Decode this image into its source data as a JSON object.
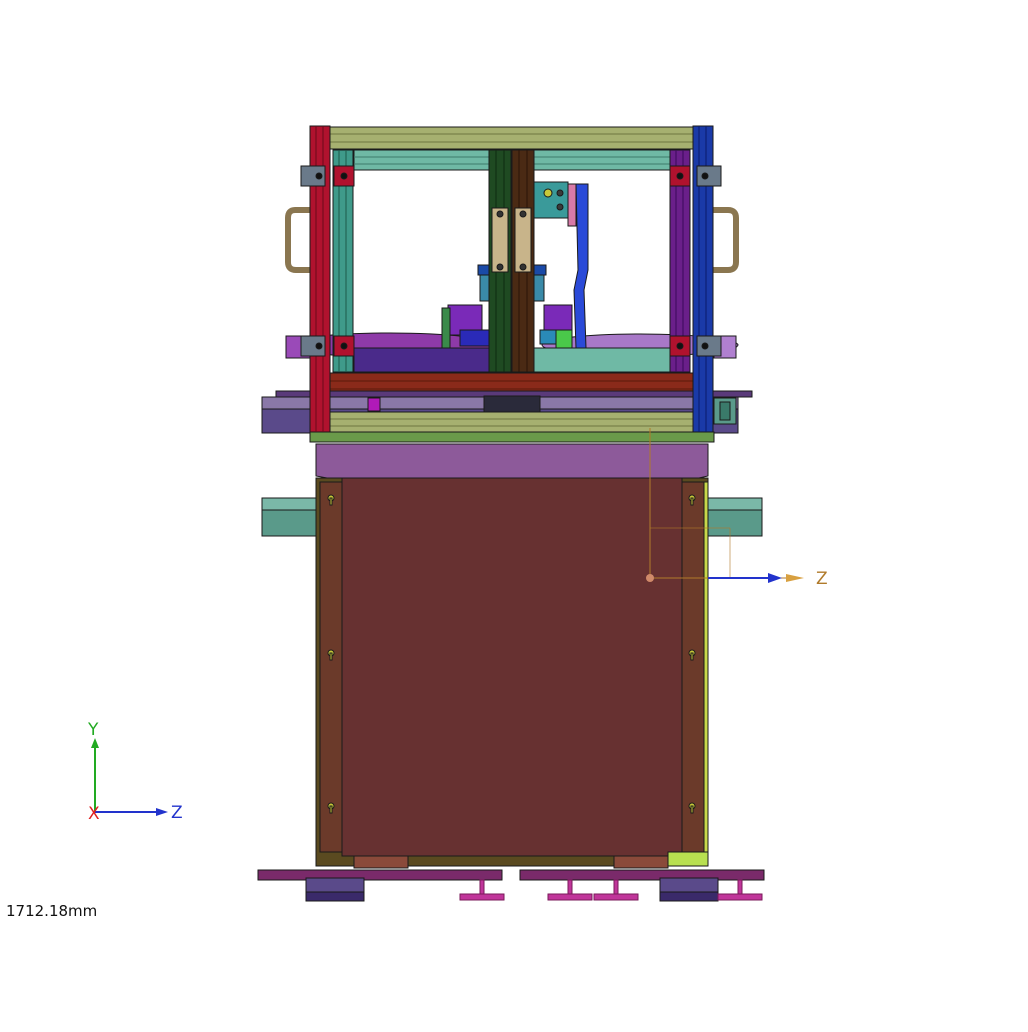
{
  "viewport": {
    "scale_readout": "1712.18mm",
    "triad": {
      "x_label": "X",
      "y_label": "Y",
      "z_label": "Z"
    },
    "origin_axis": {
      "z_label": "Z"
    }
  },
  "colors": {
    "background": "#ffffff",
    "axis_x": "#e02020",
    "axis_y": "#22aa22",
    "axis_z": "#2233cc",
    "origin_axis": "#b07a2a",
    "cabinet_panel": "#673131",
    "cabinet_top": "#8d5a9a",
    "frame_red": "#b0122e",
    "frame_teal": "#3f9a8a",
    "frame_blue": "#1a3aa8",
    "frame_purple": "#6a1f8a",
    "rail_olive": "#a6b070",
    "rail_teal": "#6fb9a5",
    "handle": "#9a8660",
    "feet": "#4a3d7a",
    "feet_rail": "#7a2a6a",
    "leveler": "#c0359a"
  }
}
